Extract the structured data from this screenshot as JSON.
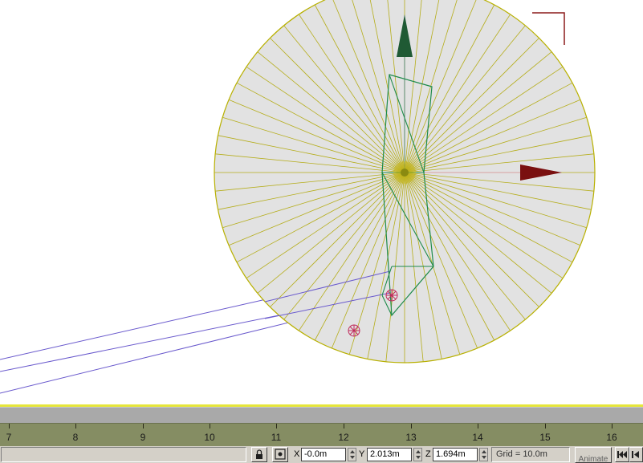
{
  "timeline": {
    "ruler_ticks": [
      "7",
      "8",
      "9",
      "10",
      "11",
      "12",
      "13",
      "14",
      "15",
      "16"
    ]
  },
  "statusbar": {
    "coords": {
      "x_label": "X",
      "x_value": "-0.0m",
      "y_label": "Y",
      "y_value": "2.013m",
      "z_label": "Z",
      "z_value": "1.694m"
    },
    "grid_text": "Grid = 10.0m",
    "animate_label": "Animate"
  },
  "icons": {
    "lock": "lock-icon",
    "absolute_mode": "absolute-mode-icon",
    "goto_start": "goto-start-icon",
    "prev_frame": "prev-frame-icon"
  },
  "colors": {
    "selection_yellow": "#e6e63a",
    "wire_green": "#1d8a4a",
    "x_axis": "#7a1010",
    "y_axis": "#1f5a34",
    "ray_violet": "#6a5acd",
    "helper_red": "#c0285a"
  }
}
